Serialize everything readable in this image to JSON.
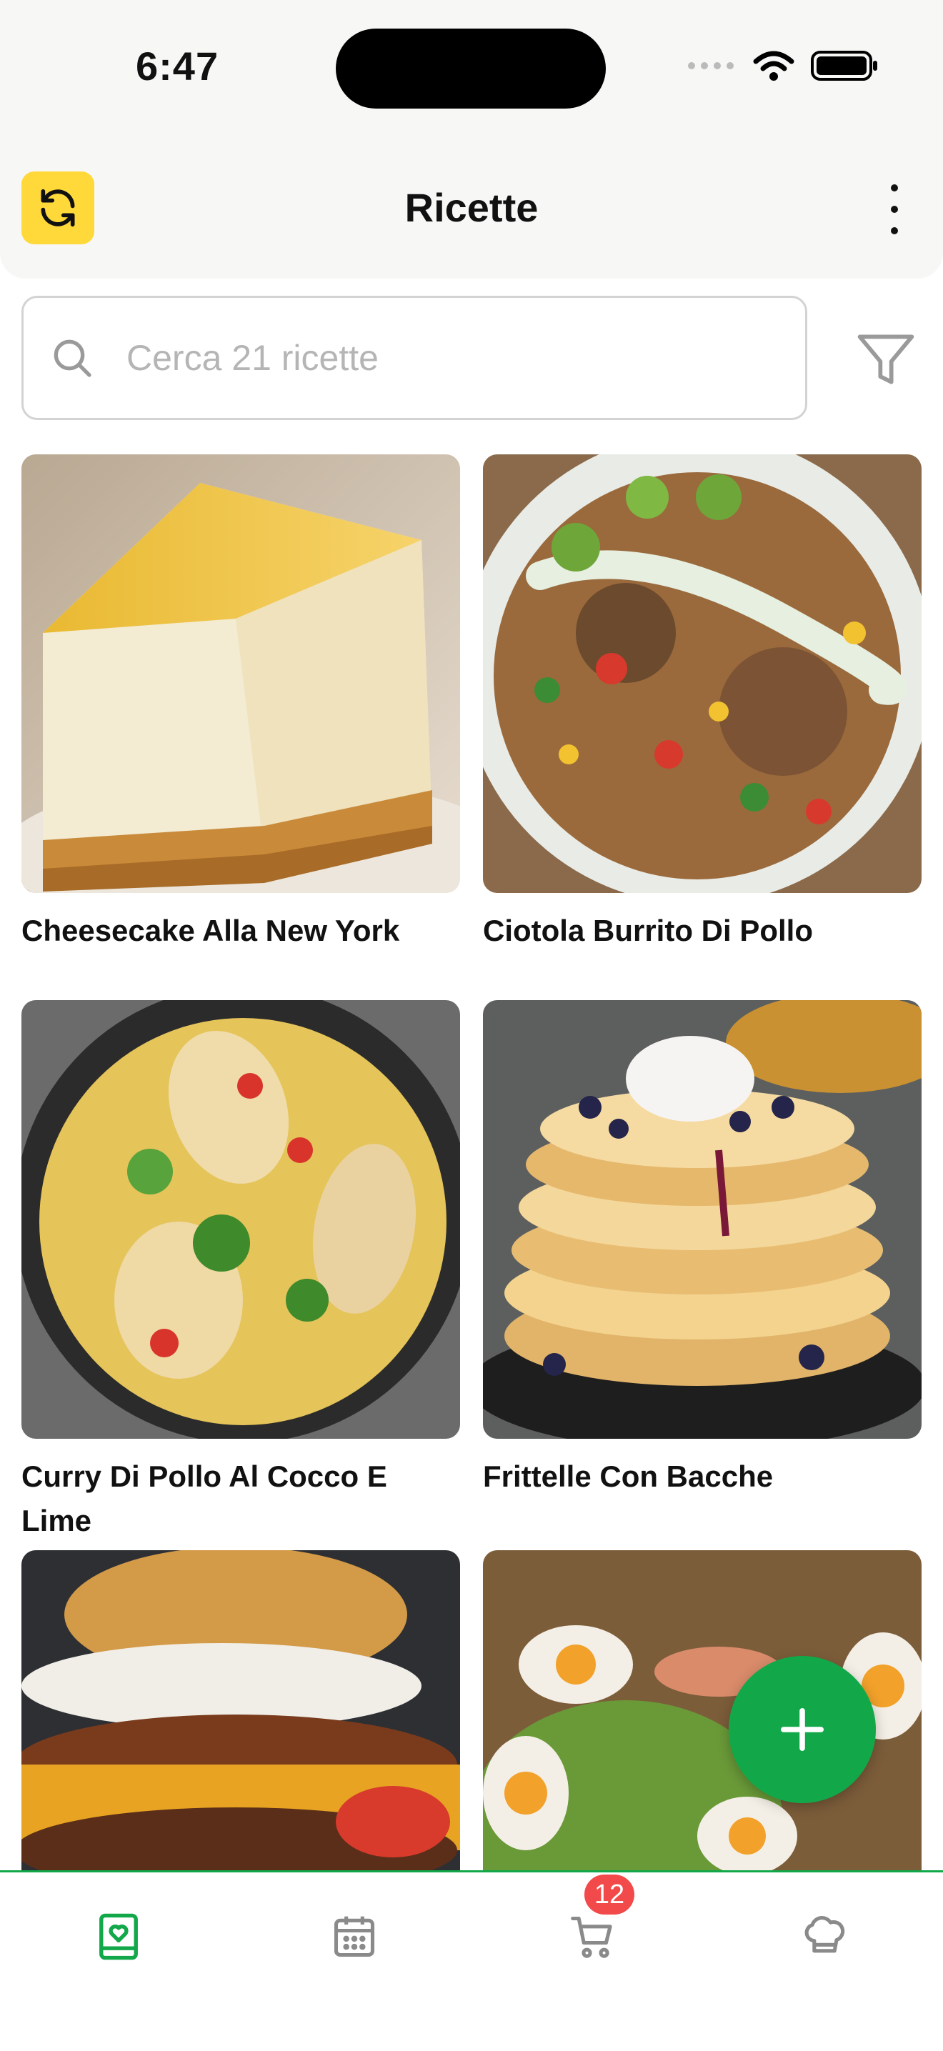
{
  "status": {
    "time": "6:47"
  },
  "header": {
    "title": "Ricette",
    "refresh_icon": "refresh-icon",
    "menu_icon": "more-vertical-icon"
  },
  "search": {
    "placeholder": "Cerca 21 ricette",
    "icon": "search-icon",
    "filter_icon": "filter-icon"
  },
  "recipes": [
    {
      "name": "Cheesecake Alla New York"
    },
    {
      "name": "Ciotola Burrito Di Pollo"
    },
    {
      "name": "Curry Di Pollo Al Cocco E Lime"
    },
    {
      "name": "Frittelle Con Bacche"
    },
    {
      "name": ""
    },
    {
      "name": ""
    }
  ],
  "fab": {
    "icon": "plus-icon"
  },
  "tabbar": {
    "tabs": [
      {
        "icon": "recipe-book-icon",
        "active": true
      },
      {
        "icon": "calendar-icon",
        "active": false
      },
      {
        "icon": "cart-icon",
        "active": false,
        "badge": "12"
      },
      {
        "icon": "chef-hat-icon",
        "active": false
      }
    ]
  },
  "colors": {
    "accent": "#12a84a",
    "refresh_bg": "#ffd83a",
    "badge": "#f24a4a"
  }
}
